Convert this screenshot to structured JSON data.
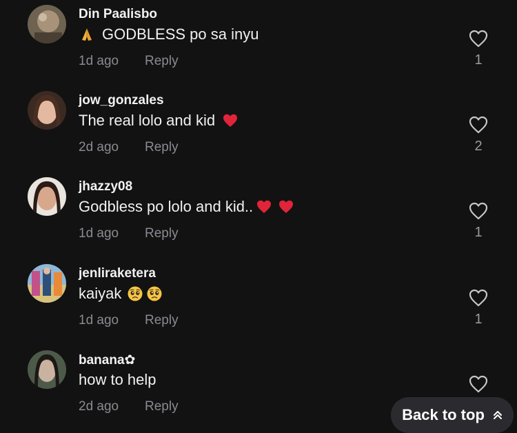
{
  "comments": [
    {
      "username": "Din Paalisbo",
      "text": "GODBLESS po sa inyu",
      "time": "1d ago",
      "reply": "Reply",
      "likes": "1",
      "emojis_before": [
        "folded-hands"
      ],
      "emojis_after": []
    },
    {
      "username": "jow_gonzales",
      "text": "The real lolo and kid",
      "time": "2d ago",
      "reply": "Reply",
      "likes": "2",
      "emojis_before": [],
      "emojis_after": [
        "red-heart"
      ]
    },
    {
      "username": "jhazzy08",
      "text": "Godbless po lolo and kid..",
      "time": "1d ago",
      "reply": "Reply",
      "likes": "1",
      "emojis_before": [],
      "emojis_after": [
        "red-heart",
        "red-heart"
      ]
    },
    {
      "username": "jenliraketera",
      "text": "kaiyak",
      "time": "1d ago",
      "reply": "Reply",
      "likes": "1",
      "emojis_before": [],
      "emojis_after": [
        "pleading-face",
        "pleading-face"
      ]
    },
    {
      "username": "banana✿",
      "text": "how to help",
      "time": "2d ago",
      "reply": "Reply",
      "likes": "",
      "emojis_before": [],
      "emojis_after": []
    }
  ],
  "back_to_top": {
    "label": "Back to top",
    "icon": "double-chevron-up-icon"
  },
  "colors": {
    "background": "#121212",
    "username": "#f1f1f2",
    "meta": "#8a8b91",
    "back_to_top_bg": "#2b2b2f",
    "heart_emoji": "#e0243a"
  }
}
